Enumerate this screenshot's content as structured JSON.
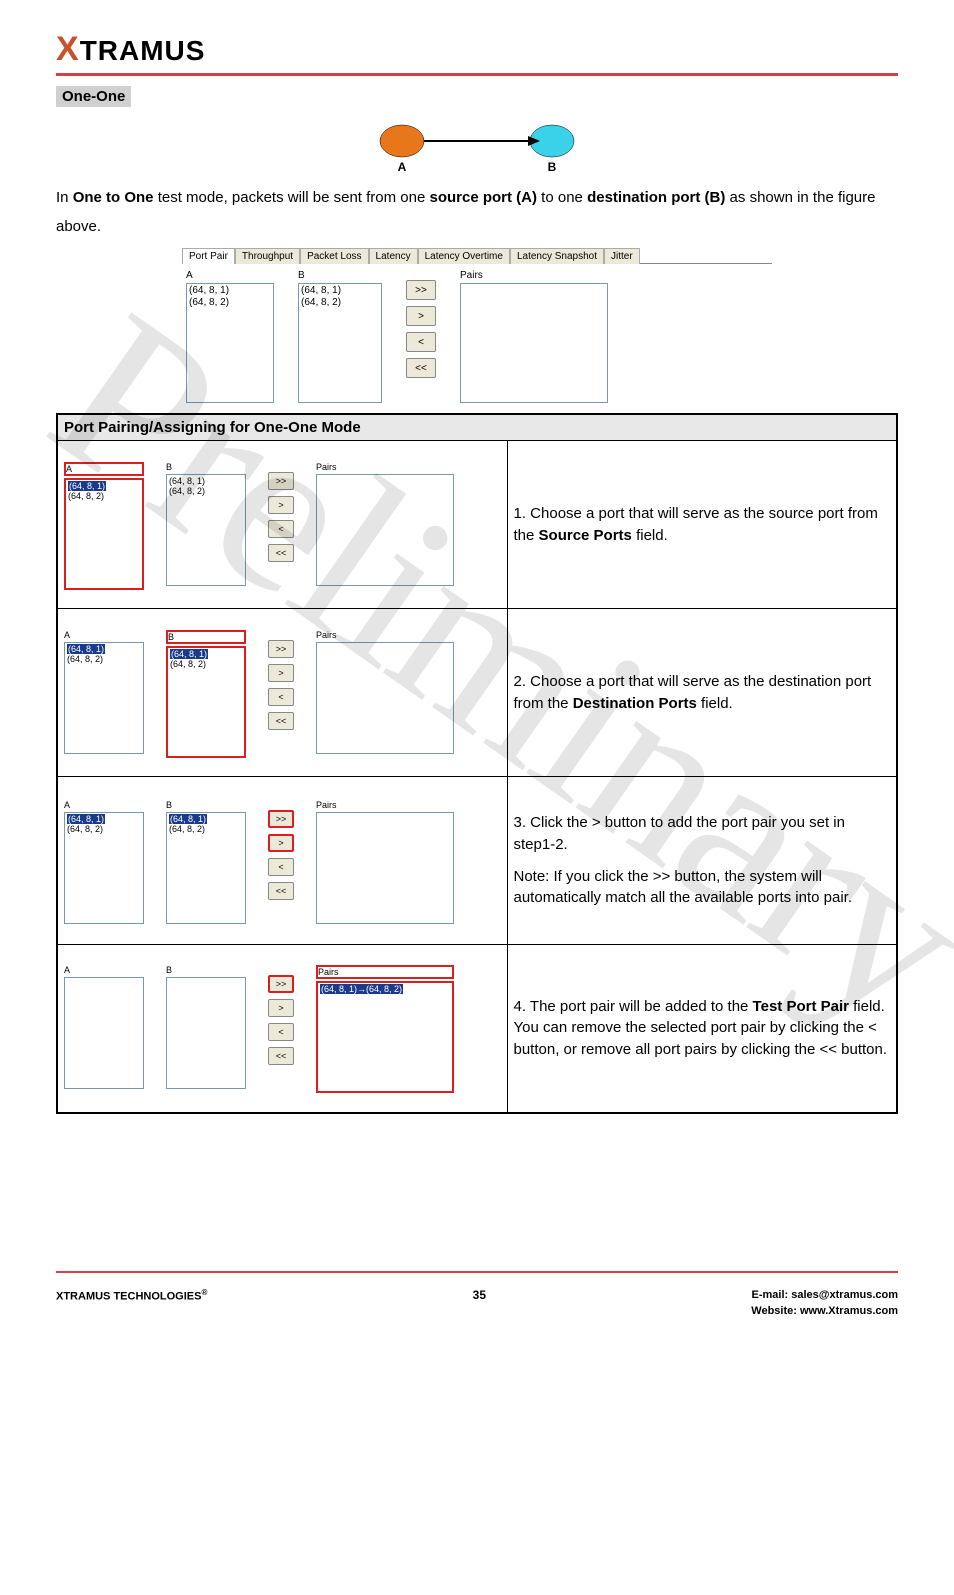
{
  "logo": {
    "x": "X",
    "rest": "TRAMUS"
  },
  "section_title": "One-One",
  "diagram": {
    "a_label": "A",
    "b_label": "B"
  },
  "intro": {
    "p1_pre": "In ",
    "p1_b1": "One to One",
    "p1_mid": " test mode, packets will be sent from one ",
    "p1_b2": "source port (A)",
    "p1_mid2": " to one ",
    "p1_b3": "destination port (B)",
    "p1_end": " as shown in the figure above."
  },
  "port_panel": {
    "tabs": [
      "Port Pair",
      "Throughput",
      "Packet Loss",
      "Latency",
      "Latency Overtime",
      "Latency Snapshot",
      "Jitter"
    ],
    "col_a": "A",
    "col_b": "B",
    "col_pairs": "Pairs",
    "a_items": [
      "(64, 8, 1)",
      "(64, 8, 2)"
    ],
    "b_items": [
      "(64, 8, 1)",
      "(64, 8, 2)"
    ],
    "btn_allright": ">>",
    "btn_right": ">",
    "btn_left": "<",
    "btn_allleft": "<<"
  },
  "table": {
    "header": "Port Pairing/Assigning for One-One Mode",
    "rows": [
      {
        "step_pre": "1. Choose a port that will serve as the source port from the ",
        "step_b": "Source Ports",
        "step_post": " field.",
        "img": {
          "a_sel": true,
          "b_sel": false,
          "pairs": [],
          "highlight": "a0"
        }
      },
      {
        "step_pre": "2. Choose a port that will serve as the destination port from the ",
        "step_b": "Destination Ports",
        "step_post": " field.",
        "img": {
          "a_sel": true,
          "b_sel": true,
          "pairs": [],
          "highlight": "both"
        }
      },
      {
        "step_pre": "3. Click the > button to add the port pair you set in step1-2.",
        "step_b": "",
        "step_post": "",
        "note": "Note: If you click the >> button, the system will automatically match all the available ports into pair.",
        "img": {
          "a_sel": true,
          "b_sel": true,
          "pairs": [],
          "highlight": "btn"
        }
      },
      {
        "step_pre": "4. The port pair will be added to the ",
        "step_b": "Test Port Pair",
        "step_post": " field. You can remove the selected port pair by clicking the < button, or remove all port pairs by clicking the << button.",
        "img": {
          "a_empty": true,
          "b_empty": true,
          "pairs": [
            "(64, 8, 1)→(64, 8, 2)"
          ],
          "highlight": "pairs"
        }
      }
    ]
  },
  "watermark": "Preliminary",
  "footer": {
    "left": "XTRAMUS TECHNOLOGIES",
    "regmark": "®",
    "page": "35",
    "email_label": "E-mail: ",
    "email": "sales@xtramus.com",
    "website_label": "Website:  ",
    "website": "www.Xtramus.com"
  }
}
